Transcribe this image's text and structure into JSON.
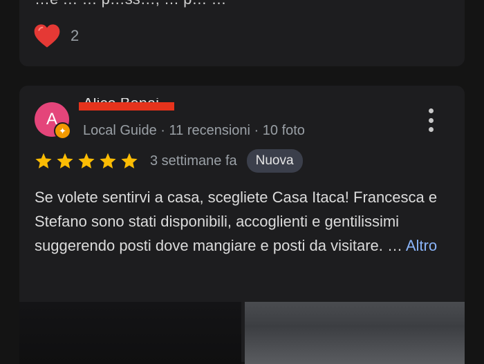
{
  "previous_review": {
    "text_fragment": "…e … … p…ss…, … p… …",
    "reaction_count": "2",
    "reaction_icon": "heart-icon",
    "heart_color": "#e53935"
  },
  "review": {
    "avatar_letter": "A",
    "avatar_color": "#e4457a",
    "reviewer_name": "Alice Benai",
    "meta": "Local Guide · 11 recensioni · 10 foto",
    "rating": 5,
    "rating_max": 5,
    "time_ago": "3 settimane fa",
    "new_badge": "Nuova",
    "text": "Se volete sentirvi a casa, scegliete Casa Itaca! Francesca e Stefano sono stati disponibili, accoglienti e gentilissimi suggerendo posti dove mangiare e posti da visitare. … ",
    "more_label": "Altro",
    "star_color": "#fbbc04",
    "link_color": "#8ab4f8"
  }
}
